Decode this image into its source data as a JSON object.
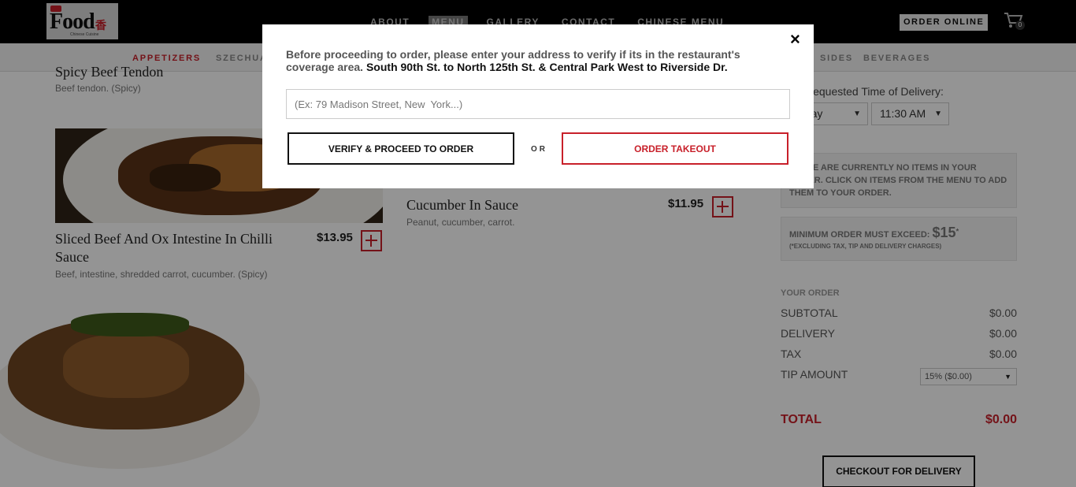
{
  "header": {
    "logo_text": "Food",
    "logo_cn": "香",
    "logo_sub": "Chinese Cuisine",
    "nav": [
      "ABOUT",
      "MENU",
      "GALLERY",
      "CONTACT",
      "CHINESE MENU"
    ],
    "order_online": "ORDER ONLINE",
    "cart_count": "0"
  },
  "categories": {
    "appetizers": "APPETIZERS",
    "szechuan": "SZECHUAN",
    "sides": "SIDES",
    "beverages": "BEVERAGES"
  },
  "menu": {
    "items": [
      {
        "title": "Spicy Beef Tendon",
        "desc": "Beef tendon. (Spicy)"
      },
      {
        "title": "Sliced Beef And Ox Intestine In Chilli Sauce",
        "desc": "Beef, intestine, shredded carrot, cucumber. (Spicy)",
        "price": "$13.95"
      },
      {
        "title": "Cucumber In Sauce",
        "desc": "Peanut, cucumber, carrot.",
        "price": "$11.95"
      }
    ]
  },
  "order_panel": {
    "delivery_label": "Requested Time of Delivery:",
    "day_select": "Today",
    "time_select": "11:30 AM",
    "empty_notice": "THERE ARE CURRENTLY NO ITEMS IN YOUR ORDER. CLICK ON ITEMS FROM THE MENU TO ADD THEM TO YOUR ORDER.",
    "min_order_label": "MINIMUM ORDER MUST EXCEED:",
    "min_order_amount": "$15",
    "min_order_note": "(*EXCLUDING TAX, TIP AND DELIVERY CHARGES)",
    "your_order": "YOUR ORDER",
    "subtotal_label": "SUBTOTAL",
    "subtotal": "$0.00",
    "delivery_fee_label": "DELIVERY",
    "delivery_fee": "$0.00",
    "tax_label": "TAX",
    "tax": "$0.00",
    "tip_label": "TIP AMOUNT",
    "tip_select": "15% ($0.00)",
    "total_label": "TOTAL",
    "total": "$0.00",
    "checkout": "CHECKOUT FOR DELIVERY"
  },
  "modal": {
    "message": "Before proceeding to order, please enter your address to verify if its in the restaurant's coverage area.",
    "coverage": "South 90th St. to North 125th St. & Central Park West to Riverside Dr.",
    "address_placeholder": "(Ex: 79 Madison Street, New  York...)",
    "verify_button": "VERIFY & PROCEED TO ORDER",
    "or_text": "OR",
    "takeout_button": "ORDER TAKEOUT",
    "close": "×"
  },
  "colors": {
    "accent": "#c8202a",
    "topbar": "#000000",
    "overlay": "rgba(0,0,0,0.42)"
  }
}
